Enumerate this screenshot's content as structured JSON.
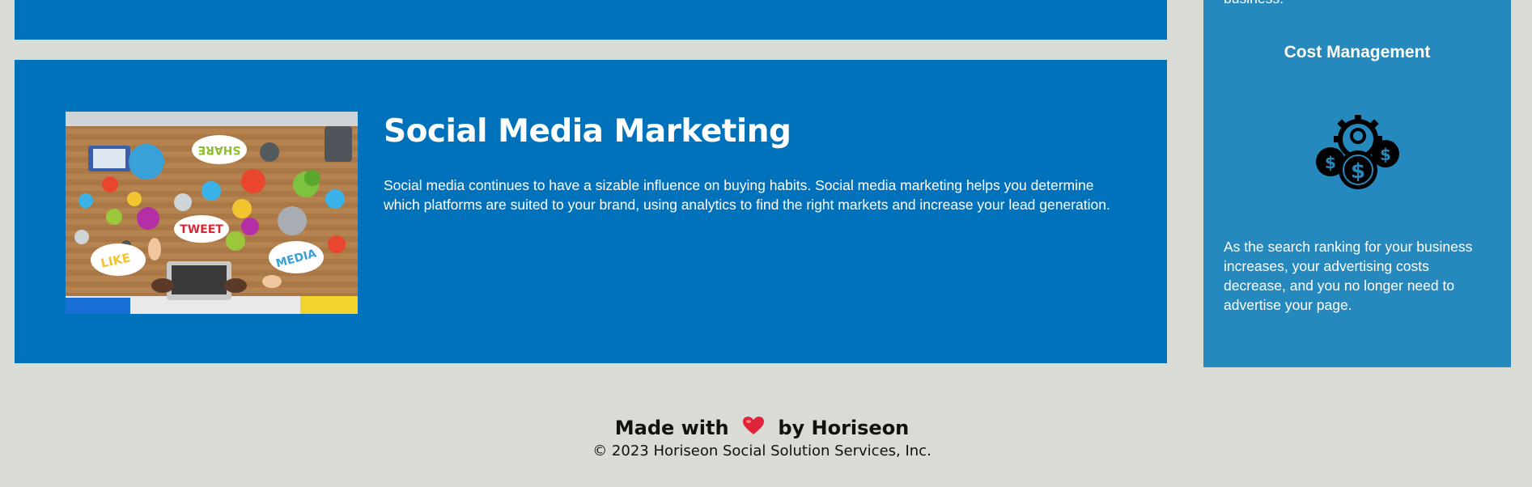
{
  "services": {
    "social_media": {
      "title": "Social Media Marketing",
      "image_alt": "Social media marketing collaboration with icons",
      "image_words": [
        "SHARE",
        "TWEET",
        "LIKE",
        "MEDIA"
      ],
      "description": "Social media continues to have a sizable influence on buying habits. Social media marketing helps you determine which platforms are suited to your brand, using analytics to find the right markets and increase your lead generation."
    }
  },
  "benefits": {
    "previous_text_fragment": "business.",
    "cost_management": {
      "title": "Cost Management",
      "icon": "cost-management-icon",
      "description": "As the search ranking for your business increases, your advertising costs decrease, and you no longer need to advertise your page."
    }
  },
  "footer": {
    "made_with": "Made with",
    "heart_icon": "heart-icon",
    "by": "by Horiseon",
    "copyright": "© 2023 Horiseon Social Solution Services, Inc."
  },
  "colors": {
    "card_blue": "#0072bc",
    "sidebar_blue": "#2589bd",
    "background": "#d9dbd5",
    "heart": "#e0243a"
  }
}
